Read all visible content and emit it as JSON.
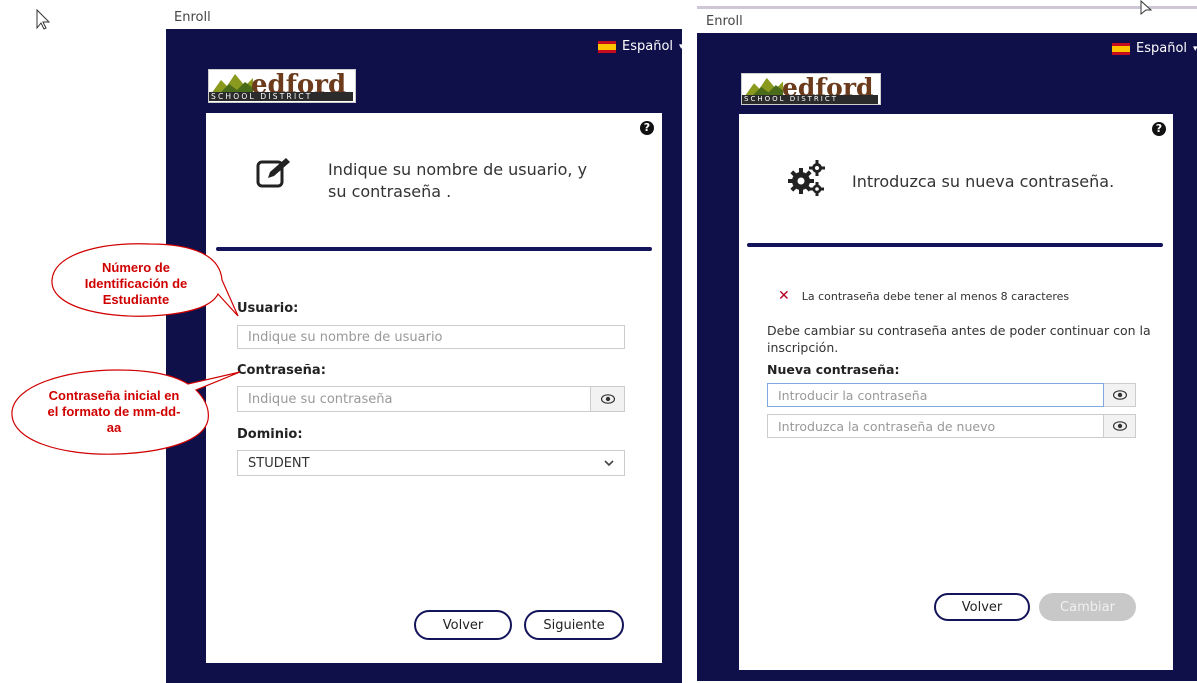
{
  "left": {
    "window_title": "Enroll",
    "language": "Español",
    "logo": {
      "brand": "edford",
      "sub": "SCHOOL DISTRICT"
    },
    "card_title": "Indique su nombre de usuario, y su contraseña .",
    "fields": {
      "username_label": "Usuario:",
      "username_placeholder": "Indique su nombre de usuario",
      "password_label": "Contraseña:",
      "password_placeholder": "Indique su contraseña",
      "domain_label": "Dominio:",
      "domain_value": "STUDENT"
    },
    "buttons": {
      "back": "Volver",
      "next": "Siguiente"
    }
  },
  "right": {
    "window_title": "Enroll",
    "language": "Español",
    "logo": {
      "brand": "edford",
      "sub": "SCHOOL DISTRICT"
    },
    "card_title": "Introduzca su nueva contraseña.",
    "error": "La contraseña debe tener al menos 8 caracteres",
    "info": "Debe cambiar su contraseña antes de poder continuar con la inscripción.",
    "new_password_label": "Nueva contraseña:",
    "new_password_placeholder": "Introducir la contraseña",
    "confirm_password_placeholder": "Introduzca la contraseña de nuevo",
    "buttons": {
      "back": "Volver",
      "change": "Cambiar"
    }
  },
  "callouts": {
    "student_id": "Número de Identificación de Estudiante",
    "initial_password": "Contraseña inicial en el formato de mm-dd-aa"
  },
  "colors": {
    "panel": "#0f0f4a",
    "accent": "#14145a",
    "callout_text": "#d00000",
    "callout_border": "#d00000"
  }
}
